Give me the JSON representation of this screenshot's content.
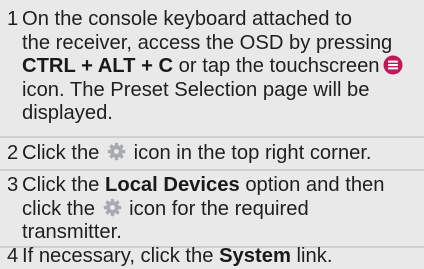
{
  "steps": [
    {
      "number": "1",
      "lines": [
        "On the console keyboard attached to",
        "the receiver, access the OSD by pressing",
        "CTRL + ALT + C",
        "or tap the touchscreen",
        "icon. The Preset Selection page will be",
        "displayed."
      ]
    },
    {
      "number": "2",
      "parts": [
        "Click the",
        "icon in the top right corner."
      ]
    },
    {
      "number": "3",
      "parts": [
        "Click the",
        "Local Devices",
        "option and then",
        "click the",
        "icon for the required",
        "transmitter."
      ]
    },
    {
      "number": "4",
      "parts": [
        "If necessary, click the",
        "System",
        "link."
      ]
    }
  ],
  "icons": {
    "menu": "menu-circle-icon",
    "settings": "gear-icon"
  },
  "colors": {
    "background": "#e9e9ea",
    "text": "#1f1f1f",
    "menu_icon": "#c2185b",
    "gear_icon": "#a7aaaf",
    "divider": "#d0d0d0"
  }
}
